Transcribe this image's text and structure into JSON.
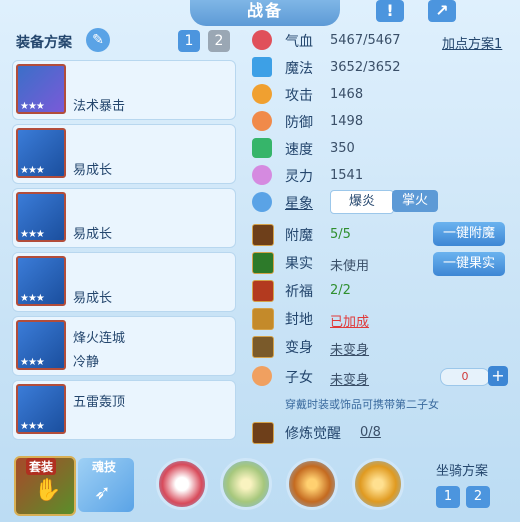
{
  "title": "战备",
  "plan_label": "装备方案",
  "plan_buttons": [
    "1",
    "2"
  ],
  "equipment": [
    {
      "name": "法术暴击",
      "name2": "",
      "stars": "★★★"
    },
    {
      "name": "易成长",
      "name2": "",
      "stars": "★★★"
    },
    {
      "name": "易成长",
      "name2": "",
      "stars": "★★★"
    },
    {
      "name": "易成长",
      "name2": "",
      "stars": "★★★"
    },
    {
      "name": "烽火连城",
      "name2": "冷静",
      "stars": "★★★"
    },
    {
      "name": "五雷轰顶",
      "name2": "",
      "stars": "★★★"
    }
  ],
  "stats": [
    {
      "icon": "heart-icon",
      "name": "气血",
      "value": "5467/5467",
      "color": "#e0505a"
    },
    {
      "icon": "diamond-icon",
      "name": "魔法",
      "value": "3652/3652",
      "color": "#3da0e6"
    },
    {
      "icon": "sword-icon",
      "name": "攻击",
      "value": "1468",
      "color": "#f0a030"
    },
    {
      "icon": "shield-icon",
      "name": "防御",
      "value": "1498",
      "color": "#f08a4a"
    },
    {
      "icon": "lightning-icon",
      "name": "速度",
      "value": "350",
      "color": "#36b56a"
    },
    {
      "icon": "spirit-icon",
      "name": "灵力",
      "value": "1541",
      "color": "#d58ae0"
    }
  ],
  "add_points_label": "加点方案1",
  "constellation": {
    "label": "星象",
    "tabs": [
      "爆炎",
      "掌火"
    ]
  },
  "rows": [
    {
      "name": "附魔",
      "value": "5/5",
      "value_color": "#2f8f2f"
    },
    {
      "name": "果实",
      "value": "未使用",
      "value_color": "#3a4f68"
    },
    {
      "name": "祈福",
      "value": "2/2",
      "value_color": "#2f8f2f"
    },
    {
      "name": "封地",
      "value": "已加成",
      "value_color": "#e03a3a"
    },
    {
      "name": "变身",
      "value": "未变身",
      "value_color": "#3a4f68"
    },
    {
      "name": "子女",
      "value": "未变身",
      "value_color": "#3a4f68"
    }
  ],
  "buttons": {
    "enchant": "一键附魔",
    "fruit": "一键果实"
  },
  "child_count": "0",
  "hint": "穿戴时装或饰品可携带第二子女",
  "cultivation": {
    "name": "修炼觉醒",
    "value": "0/8"
  },
  "bottom_tabs": [
    "套装",
    "魂技"
  ],
  "mount": {
    "label": "坐骑方案",
    "buttons": [
      "1",
      "2"
    ]
  }
}
